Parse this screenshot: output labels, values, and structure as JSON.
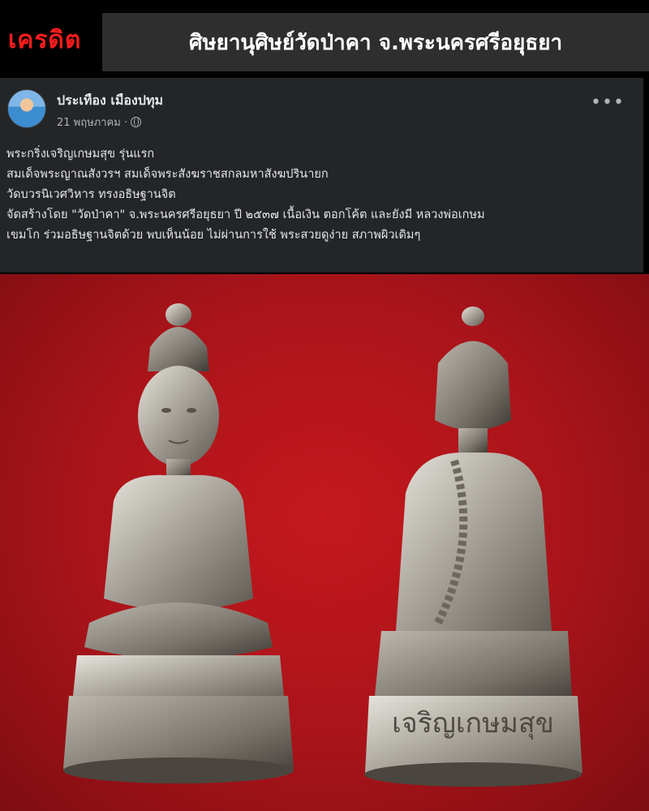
{
  "banner": {
    "brand": "เครดิต",
    "title": "ศิษยานุศิษย์วัดป่าคา จ.พระนครศรีอยุธยา",
    "brand_color": "#ff1d1d"
  },
  "post": {
    "author": "ประเทือง เมืองปทุม",
    "date": "21 พฤษภาคม ·",
    "privacy_icon": "globe-icon",
    "more_icon": "more-options-icon",
    "more_label": "•••",
    "lines": [
      "พระกริ่งเจริญเกษมสุข รุ่นแรก",
      "สมเด็จพระญาณสังวรฯ สมเด็จพระสังฆราชสกลมหาสังฆปรินายก",
      "วัดบวรนิเวศวิหาร ทรงอธิษฐานจิต",
      " จัดสร้างโดย \"วัดป่าคา\" จ.พระนครศรีอยุธยา ปี ๒๕๓๗ เนื้อเงิน ตอกโค้ต และยังมี หลวงพ่อเกษม",
      "เขมโก ร่วมอธิษฐานจิตด้วย พบเห็นน้อย ไม่ผ่านการใช้ พระสวยดูง่าย สภาพผิวเดิมๆ"
    ]
  },
  "photo": {
    "background_color": "#b3161b",
    "base_inscription": "เจริญเกษมสุข"
  }
}
